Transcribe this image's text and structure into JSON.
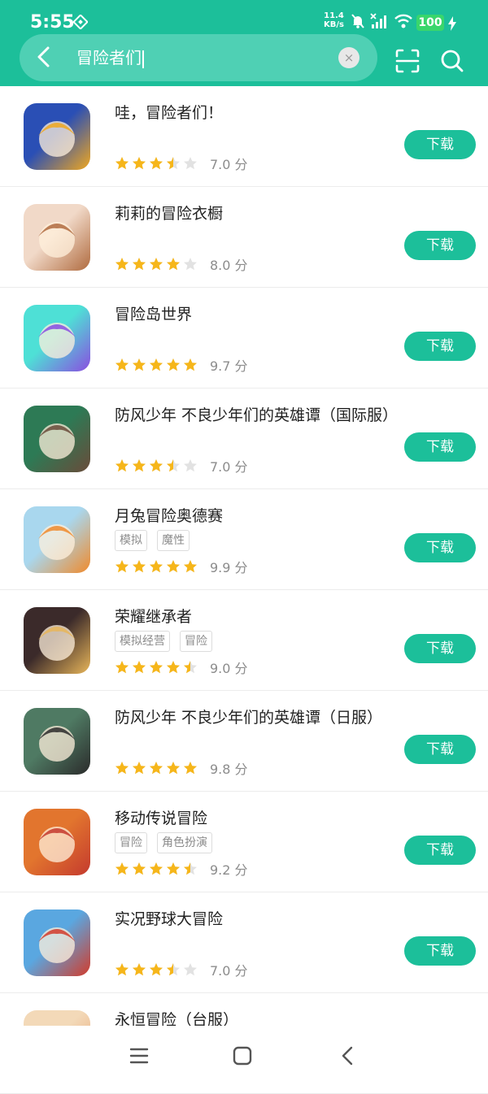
{
  "status_bar": {
    "time": "5:55",
    "net_speed_value": "11.4",
    "net_speed_unit": "KB/s",
    "battery": "100"
  },
  "search": {
    "query": "冒险者们",
    "clear_symbol": "×"
  },
  "download_label": "下载",
  "score_suffix": "分",
  "apps": [
    {
      "title": "哇，冒险者们！",
      "tags": [],
      "rating": 3.5,
      "score": "7.0",
      "colors": [
        "#2a4fb5",
        "#f0a71f"
      ]
    },
    {
      "title": "莉莉的冒险衣橱",
      "tags": [],
      "rating": 4.0,
      "score": "8.0",
      "colors": [
        "#f1d9c8",
        "#b06b3f"
      ]
    },
    {
      "title": "冒险岛世界",
      "tags": [],
      "rating": 5.0,
      "score": "9.7",
      "colors": [
        "#4ee0d6",
        "#8a4de0"
      ]
    },
    {
      "title": "防风少年 不良少年们的英雄谭（国际服）",
      "tags": [],
      "rating": 3.5,
      "score": "7.0",
      "colors": [
        "#2d7a55",
        "#6a4b3a"
      ]
    },
    {
      "title": "月兔冒险奥德赛",
      "tags": [
        "模拟",
        "魔性"
      ],
      "rating": 5.0,
      "score": "9.9",
      "colors": [
        "#a9d7ee",
        "#f08a2c"
      ]
    },
    {
      "title": "荣耀继承者",
      "tags": [
        "模拟经营",
        "冒险"
      ],
      "rating": 4.5,
      "score": "9.0",
      "colors": [
        "#3b2a2a",
        "#e8b65a"
      ]
    },
    {
      "title": "防风少年 不良少年们的英雄谭（日服）",
      "tags": [],
      "rating": 5.0,
      "score": "9.8",
      "colors": [
        "#4f7a63",
        "#2b2b2b"
      ]
    },
    {
      "title": "移动传说冒险",
      "tags": [
        "冒险",
        "角色扮演"
      ],
      "rating": 4.5,
      "score": "9.2",
      "colors": [
        "#e2752e",
        "#c43a2e"
      ]
    },
    {
      "title": "实况野球大冒险",
      "tags": [],
      "rating": 3.5,
      "score": "7.0",
      "colors": [
        "#5aa7e0",
        "#d23b2b"
      ]
    },
    {
      "title": "永恒冒险（台服）",
      "tags": [],
      "rating": 0,
      "score": "",
      "colors": [
        "#f3d9b8",
        "#e8a070"
      ]
    }
  ],
  "colors": {
    "accent": "#1cbf9a",
    "star": "#f6b61a",
    "star_empty": "#e2e2e2"
  }
}
